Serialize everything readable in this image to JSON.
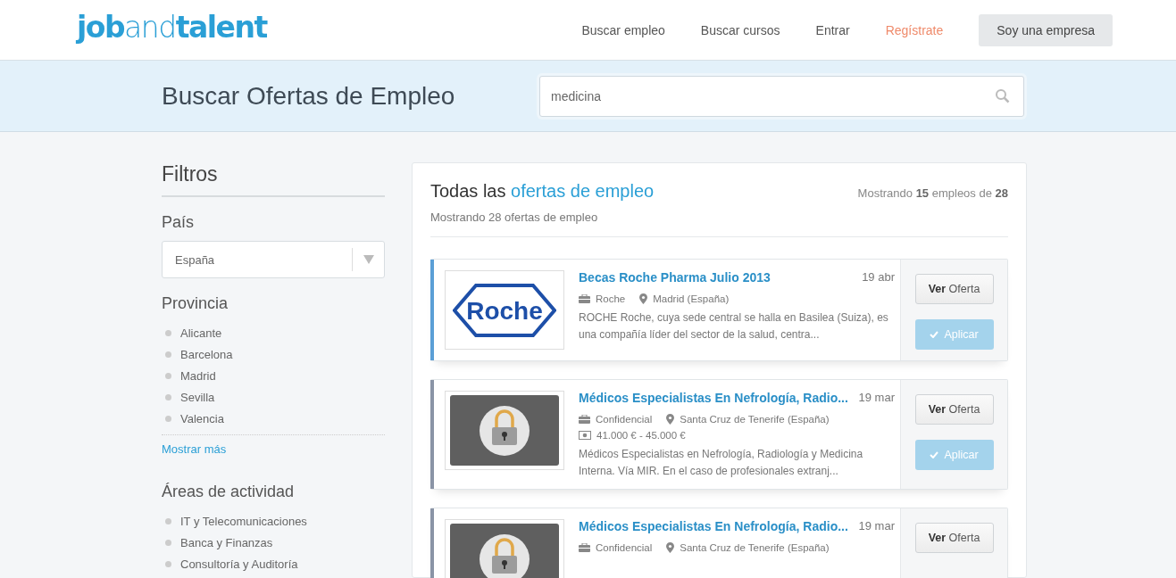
{
  "header": {
    "logo": "**job**and**talent**",
    "nav": [
      {
        "label": "Buscar empleo",
        "kind": "link"
      },
      {
        "label": "Buscar cursos",
        "kind": "link"
      },
      {
        "label": "Entrar",
        "kind": "link"
      },
      {
        "label": "Regístrate",
        "kind": "highlight"
      },
      {
        "label": "Soy una empresa",
        "kind": "button"
      }
    ]
  },
  "search_band": {
    "title": "Buscar Ofertas de Empleo",
    "search": {
      "value": "medicina"
    }
  },
  "filters": {
    "title": "Filtros",
    "country": {
      "label": "País",
      "value": "España"
    },
    "province": {
      "label": "Provincia",
      "items": [
        "Alicante",
        "Barcelona",
        "Madrid",
        "Sevilla",
        "Valencia"
      ],
      "more": "Mostrar más"
    },
    "areas": {
      "label": "Áreas de actividad",
      "items": [
        "IT y Telecomunicaciones",
        "Banca y Finanzas",
        "Consultoría y Auditoría"
      ]
    }
  },
  "results": {
    "title": "Todas las",
    "title_link": "ofertas de empleo",
    "subtitle": "Mostrando 28 ofertas de empleo",
    "count": "Mostrando **15** empleos de **28**",
    "jobs": [
      {
        "kind": "roche",
        "logo_text": "Roche",
        "color": "#5b9fd6",
        "title": "Becas Roche Pharma Julio 2013",
        "date": "19 abr",
        "company": "Roche",
        "location": "Madrid (España)",
        "description": "ROCHE Roche, cuya sede central se halla en Basilea (Suiza), es una compañía líder del sector de la salud, centra...",
        "view": "**Ver** Oferta",
        "apply": "Aplicar"
      },
      {
        "kind": "locked",
        "color": "#8a94a6",
        "title": "Médicos Especialistas En Nefrología, Radio...",
        "date": "19 mar",
        "company": "Confidencial",
        "location": "Santa Cruz de Tenerife (España)",
        "salary": "41.000 € - 45.000 €",
        "description": "Médicos Especialistas en Nefrología, Radiología y Medicina Interna. Vía MIR. En el caso de profesionales extranj...",
        "view": "**Ver** Oferta",
        "apply": "Aplicar"
      },
      {
        "kind": "locked",
        "color": "#8a94a6",
        "title": "Médicos Especialistas En Nefrología, Radio...",
        "date": "19 mar",
        "company": "Confidencial",
        "location": "Santa Cruz de Tenerife (España)",
        "view": "**Ver** Oferta"
      }
    ]
  }
}
